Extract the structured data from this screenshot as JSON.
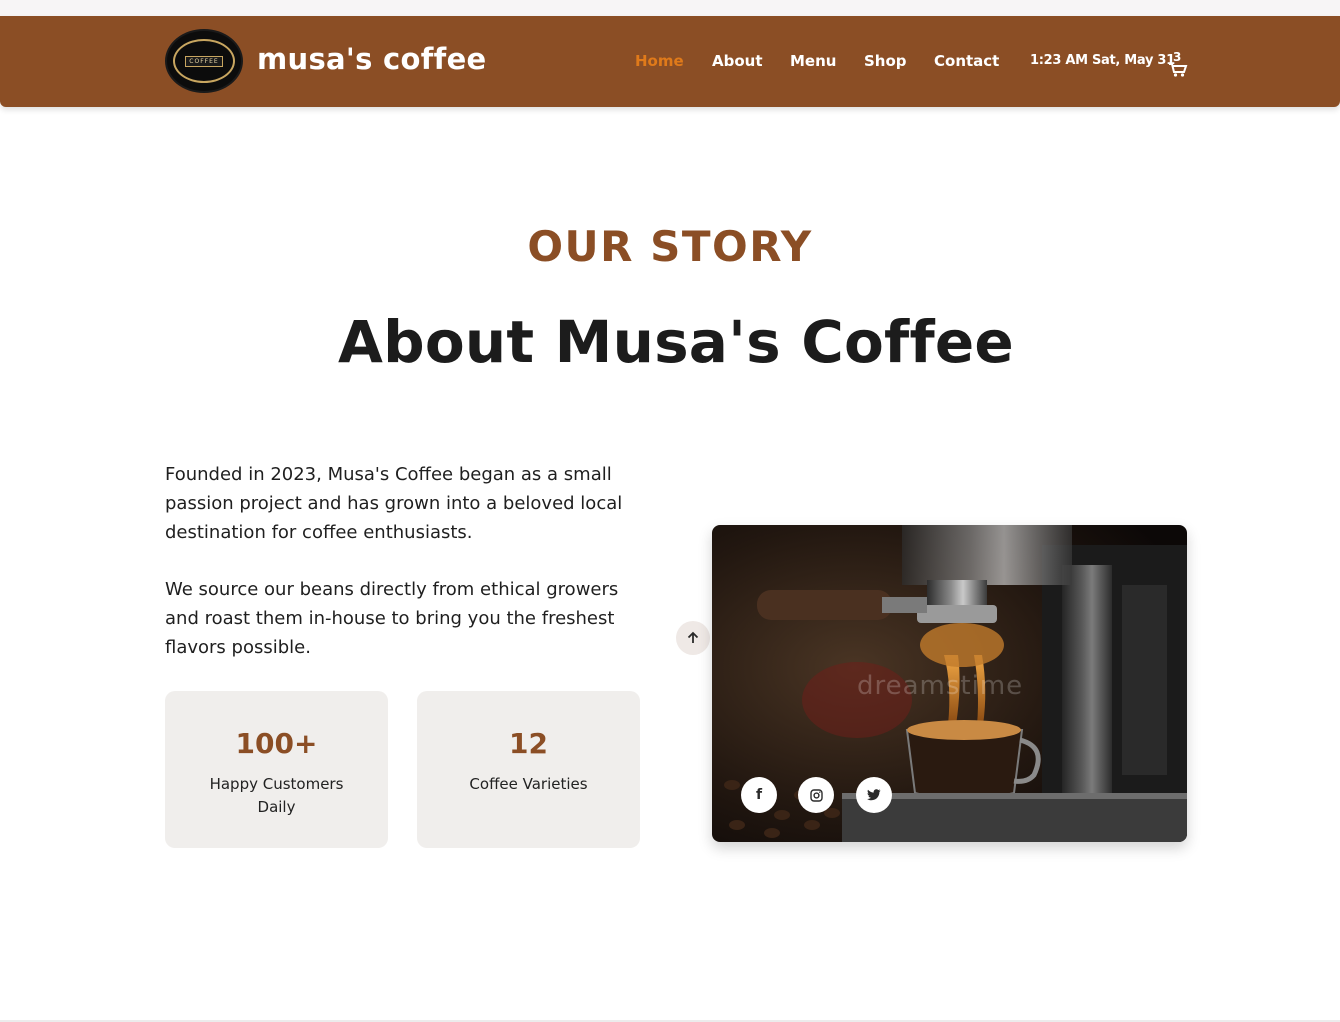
{
  "header": {
    "brand": "musa's coffee",
    "logo_text": "COFFEE",
    "nav": [
      "Home",
      "About",
      "Menu",
      "Shop",
      "Contact"
    ],
    "active_nav": "Home",
    "clock": "1:23 AM Sat, May 31",
    "cart_count": "3",
    "cart_icon": "cart-icon"
  },
  "hero": {
    "eyebrow": "OUR STORY",
    "title": "About Musa's Coffee"
  },
  "about": {
    "paragraphs": [
      "Founded in 2023, Musa's Coffee began as a small passion project and has grown into a beloved local destination for coffee enthusiasts.",
      "We source our beans directly from ethical growers and roast them in-house to bring you the freshest flavors possible."
    ],
    "stats": [
      {
        "value": "100+",
        "label": "Happy Customers Daily"
      },
      {
        "value": "12",
        "label": "Coffee Varieties"
      }
    ]
  },
  "image": {
    "watermark": "dreamstime",
    "social": [
      "facebook-icon",
      "instagram-icon",
      "twitter-icon"
    ]
  },
  "colors": {
    "brand": "#8b4e25",
    "accent": "#e07a1a",
    "stat_bg": "#f0eeec"
  }
}
